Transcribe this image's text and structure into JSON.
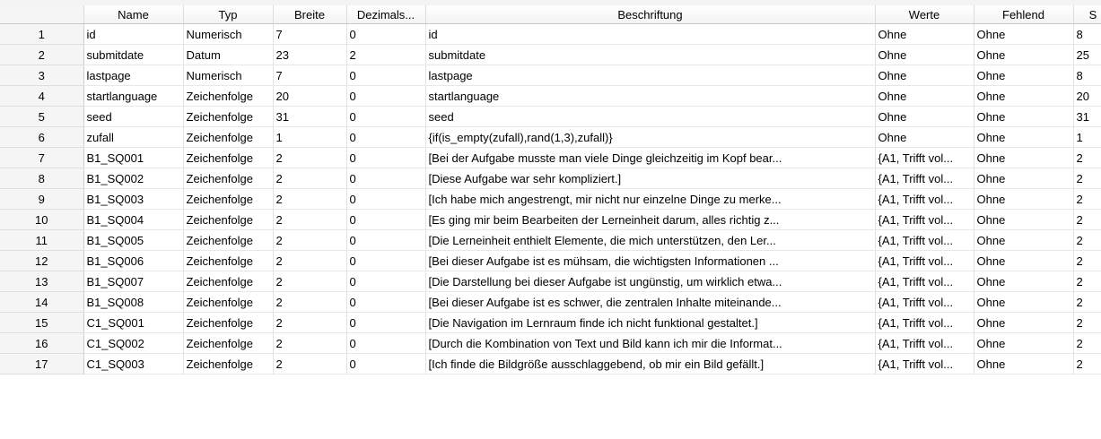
{
  "columns": [
    "Name",
    "Typ",
    "Breite",
    "Dezimals...",
    "Beschriftung",
    "Werte",
    "Fehlend",
    "S"
  ],
  "rows": [
    [
      "1",
      "id",
      "Numerisch",
      "7",
      "0",
      "id",
      "Ohne",
      "Ohne",
      "8"
    ],
    [
      "2",
      "submitdate",
      "Datum",
      "23",
      "2",
      "submitdate",
      "Ohne",
      "Ohne",
      "25"
    ],
    [
      "3",
      "lastpage",
      "Numerisch",
      "7",
      "0",
      "lastpage",
      "Ohne",
      "Ohne",
      "8"
    ],
    [
      "4",
      "startlanguage",
      "Zeichenfolge",
      "20",
      "0",
      "startlanguage",
      "Ohne",
      "Ohne",
      "20"
    ],
    [
      "5",
      "seed",
      "Zeichenfolge",
      "31",
      "0",
      "seed",
      "Ohne",
      "Ohne",
      "31"
    ],
    [
      "6",
      "zufall",
      "Zeichenfolge",
      "1",
      "0",
      "{if(is_empty(zufall),rand(1,3),zufall)}",
      "Ohne",
      "Ohne",
      "1"
    ],
    [
      "7",
      "B1_SQ001",
      "Zeichenfolge",
      "2",
      "0",
      "[Bei der Aufgabe musste man viele Dinge gleichzeitig im Kopf bear...",
      "{A1, Trifft vol...",
      "Ohne",
      "2"
    ],
    [
      "8",
      "B1_SQ002",
      "Zeichenfolge",
      "2",
      "0",
      "[Diese Aufgabe war sehr kompliziert.]",
      "{A1, Trifft vol...",
      "Ohne",
      "2"
    ],
    [
      "9",
      "B1_SQ003",
      "Zeichenfolge",
      "2",
      "0",
      "[Ich habe mich angestrengt, mir nicht nur einzelne Dinge zu merke...",
      "{A1, Trifft vol...",
      "Ohne",
      "2"
    ],
    [
      "10",
      "B1_SQ004",
      "Zeichenfolge",
      "2",
      "0",
      "[Es ging mir beim Bearbeiten der Lerneinheit darum, alles richtig z...",
      "{A1, Trifft vol...",
      "Ohne",
      "2"
    ],
    [
      "11",
      "B1_SQ005",
      "Zeichenfolge",
      "2",
      "0",
      "[Die Lerneinheit enthielt Elemente, die mich unterstützen, den Ler...",
      "{A1, Trifft vol...",
      "Ohne",
      "2"
    ],
    [
      "12",
      "B1_SQ006",
      "Zeichenfolge",
      "2",
      "0",
      "[Bei dieser Aufgabe ist es mühsam, die wichtigsten Informationen ...",
      "{A1, Trifft vol...",
      "Ohne",
      "2"
    ],
    [
      "13",
      "B1_SQ007",
      "Zeichenfolge",
      "2",
      "0",
      "[Die Darstellung bei dieser Aufgabe ist ungünstig, um wirklich etwa...",
      "{A1, Trifft vol...",
      "Ohne",
      "2"
    ],
    [
      "14",
      "B1_SQ008",
      "Zeichenfolge",
      "2",
      "0",
      "[Bei dieser Aufgabe ist es schwer, die zentralen Inhalte miteinande...",
      "{A1, Trifft vol...",
      "Ohne",
      "2"
    ],
    [
      "15",
      "C1_SQ001",
      "Zeichenfolge",
      "2",
      "0",
      "[Die Navigation im Lernraum finde ich nicht funktional gestaltet.]",
      "{A1, Trifft vol...",
      "Ohne",
      "2"
    ],
    [
      "16",
      "C1_SQ002",
      "Zeichenfolge",
      "2",
      "0",
      "[Durch die Kombination von Text und Bild kann ich mir die Informat...",
      "{A1, Trifft vol...",
      "Ohne",
      "2"
    ],
    [
      "17",
      "C1_SQ003",
      "Zeichenfolge",
      "2",
      "0",
      "[Ich finde die Bildgröße ausschlaggebend, ob mir ein Bild gefällt.]",
      "{A1, Trifft vol...",
      "Ohne",
      "2"
    ]
  ]
}
